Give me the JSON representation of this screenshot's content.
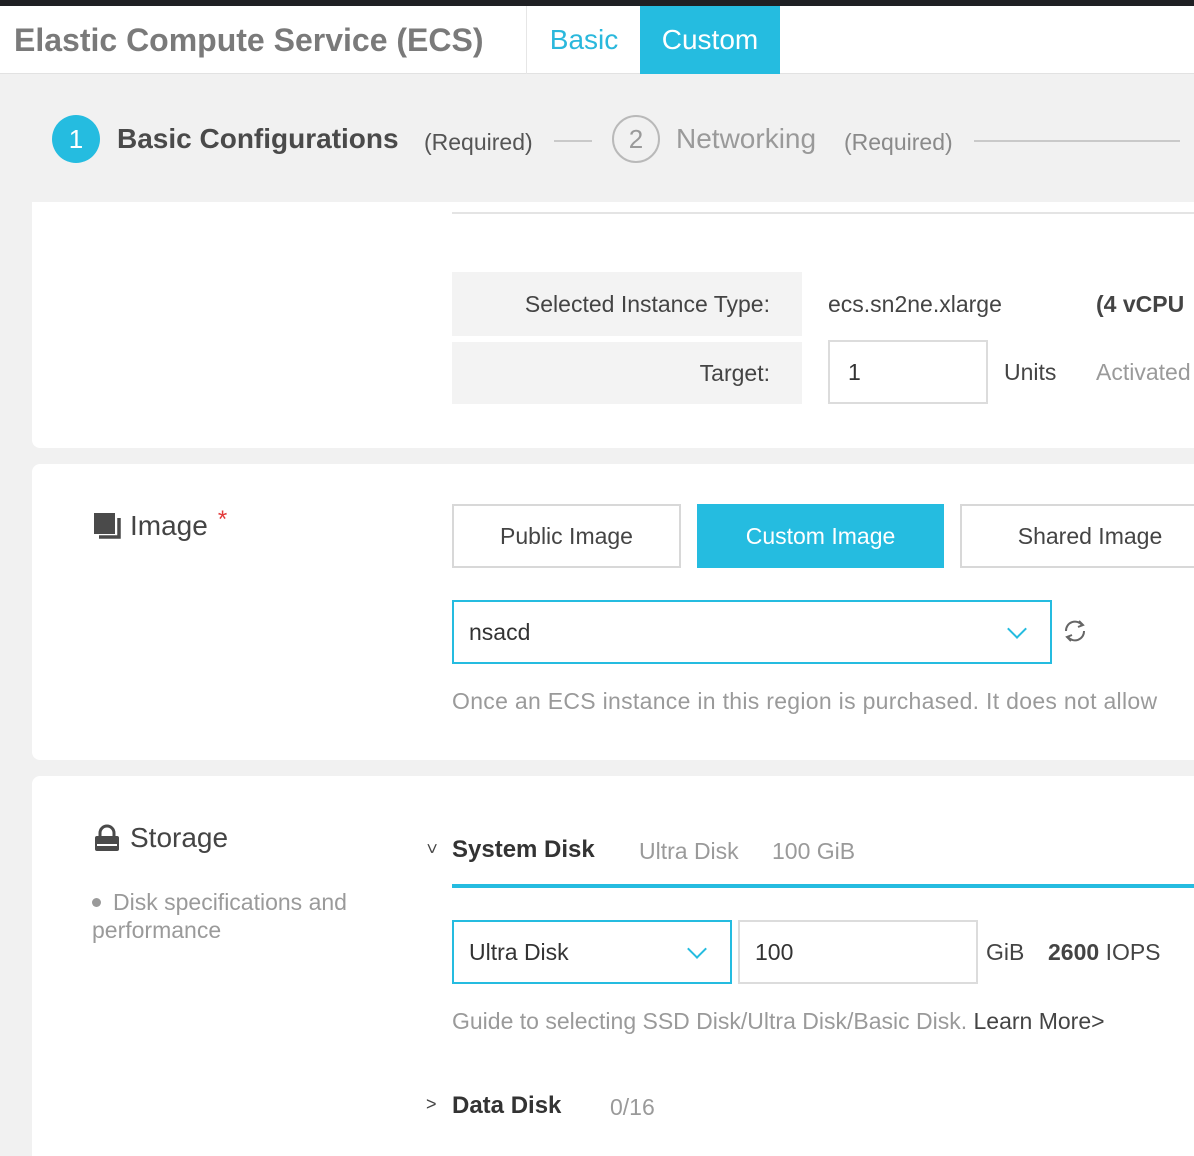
{
  "header": {
    "app_title": "Elastic Compute Service (ECS)",
    "tabs": [
      {
        "label": "Basic",
        "active": false
      },
      {
        "label": "Custom",
        "active": true
      }
    ]
  },
  "steps": [
    {
      "number": "1",
      "title": "Basic Configurations",
      "required": "(Required)",
      "active": true
    },
    {
      "number": "2",
      "title": "Networking",
      "required": "(Required)",
      "active": false
    }
  ],
  "instance": {
    "selected_label": "Selected Instance Type:",
    "selected_value": "ecs.sn2ne.xlarge",
    "spec": "(4 vCPU",
    "target_label": "Target:",
    "target_value": "1",
    "units_label": "Units",
    "activated_text": "Activated"
  },
  "image": {
    "title": "Image",
    "required_mark": "*",
    "icon": "image-stack-icon",
    "buttons": [
      {
        "label": "Public Image",
        "selected": false
      },
      {
        "label": "Custom Image",
        "selected": true
      },
      {
        "label": "Shared Image",
        "selected": false
      }
    ],
    "selected_image": "nsacd",
    "note": "Once an ECS instance in this region is purchased. It does not allow"
  },
  "storage": {
    "title": "Storage",
    "icon": "lock-icon",
    "description": "Disk specifications and performance",
    "system_disk": {
      "title": "System Disk",
      "summary_type": "Ultra Disk",
      "summary_size": "100 GiB",
      "disk_type": "Ultra Disk",
      "size": "100",
      "size_unit": "GiB",
      "iops_value": "2600",
      "iops_unit": "IOPS",
      "guide": "Guide to selecting SSD Disk/Ultra Disk/Basic Disk.",
      "learn_more": "Learn More>"
    },
    "data_disk": {
      "title": "Data Disk",
      "count": "0/16"
    }
  },
  "colors": {
    "accent": "#25bce0",
    "required": "#e23a3a",
    "muted_text": "#9a9a9a"
  }
}
